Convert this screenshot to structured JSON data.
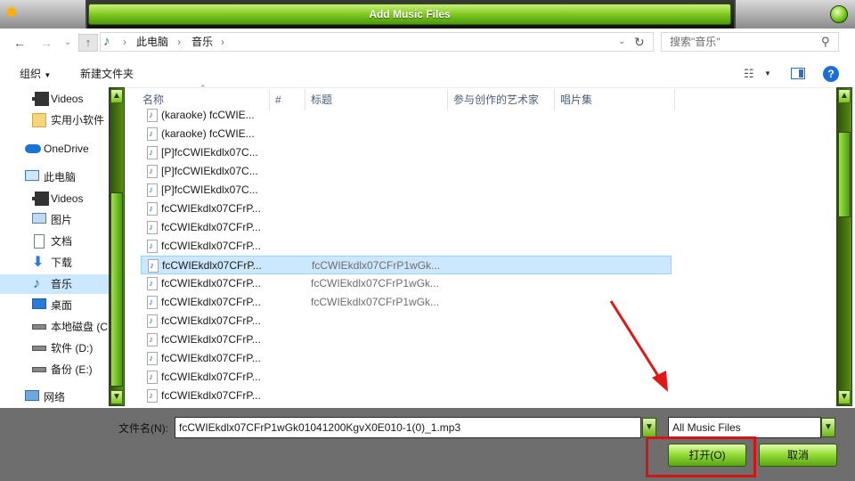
{
  "window": {
    "title": "Add Music Files"
  },
  "address": {
    "segments": [
      "此电脑",
      "音乐"
    ],
    "search_placeholder": "搜索\"音乐\""
  },
  "commands": {
    "organize": "组织",
    "new_folder": "新建文件夹"
  },
  "sidebar": {
    "items": [
      {
        "label": "Videos",
        "icon": "video-icon"
      },
      {
        "label": "实用小软件",
        "icon": "folder-icon"
      },
      {
        "label": "OneDrive",
        "icon": "cloud-icon"
      },
      {
        "label": "此电脑",
        "icon": "computer-icon"
      },
      {
        "label": "Videos",
        "icon": "video-icon"
      },
      {
        "label": "图片",
        "icon": "pictures-icon"
      },
      {
        "label": "文档",
        "icon": "documents-icon"
      },
      {
        "label": "下载",
        "icon": "download-icon"
      },
      {
        "label": "音乐",
        "icon": "music-icon",
        "selected": true
      },
      {
        "label": "桌面",
        "icon": "desktop-icon"
      },
      {
        "label": "本地磁盘 (C",
        "icon": "drive-icon"
      },
      {
        "label": "软件 (D:)",
        "icon": "drive-icon"
      },
      {
        "label": "备份 (E:)",
        "icon": "drive-icon"
      },
      {
        "label": "网络",
        "icon": "network-icon"
      }
    ]
  },
  "columns": [
    "名称",
    "#",
    "标题",
    "参与创作的艺术家",
    "唱片集"
  ],
  "files": [
    {
      "name": "(karaoke) fcCWIE...",
      "title": ""
    },
    {
      "name": "(karaoke) fcCWIE...",
      "title": ""
    },
    {
      "name": "[P]fcCWIEkdlx07C...",
      "title": ""
    },
    {
      "name": "[P]fcCWIEkdlx07C...",
      "title": ""
    },
    {
      "name": "[P]fcCWIEkdlx07C...",
      "title": ""
    },
    {
      "name": "fcCWIEkdlx07CFrP...",
      "title": ""
    },
    {
      "name": "fcCWIEkdlx07CFrP...",
      "title": ""
    },
    {
      "name": "fcCWIEkdlx07CFrP...",
      "title": ""
    },
    {
      "name": "fcCWIEkdlx07CFrP...",
      "title": "fcCWIEkdlx07CFrP1wGk...",
      "selected": true
    },
    {
      "name": "fcCWIEkdlx07CFrP...",
      "title": "fcCWIEkdlx07CFrP1wGk..."
    },
    {
      "name": "fcCWIEkdlx07CFrP...",
      "title": "fcCWIEkdlx07CFrP1wGk..."
    },
    {
      "name": "fcCWIEkdlx07CFrP...",
      "title": ""
    },
    {
      "name": "fcCWIEkdlx07CFrP...",
      "title": ""
    },
    {
      "name": "fcCWIEkdlx07CFrP...",
      "title": ""
    },
    {
      "name": "fcCWIEkdlx07CFrP...",
      "title": ""
    },
    {
      "name": "fcCWIEkdlx07CFrP...",
      "title": ""
    }
  ],
  "footer": {
    "filename_label": "文件名(N):",
    "filename_value": "fcCWIEkdlx07CFrP1wGk01041200KgvX0E010-1(0)_1.mp3",
    "filter_value": "All Music Files",
    "open_label": "打开(O)",
    "cancel_label": "取消"
  },
  "colors": {
    "accent_green": "#7bc51c",
    "selection": "#cce8ff",
    "highlight_red": "#d41414"
  }
}
